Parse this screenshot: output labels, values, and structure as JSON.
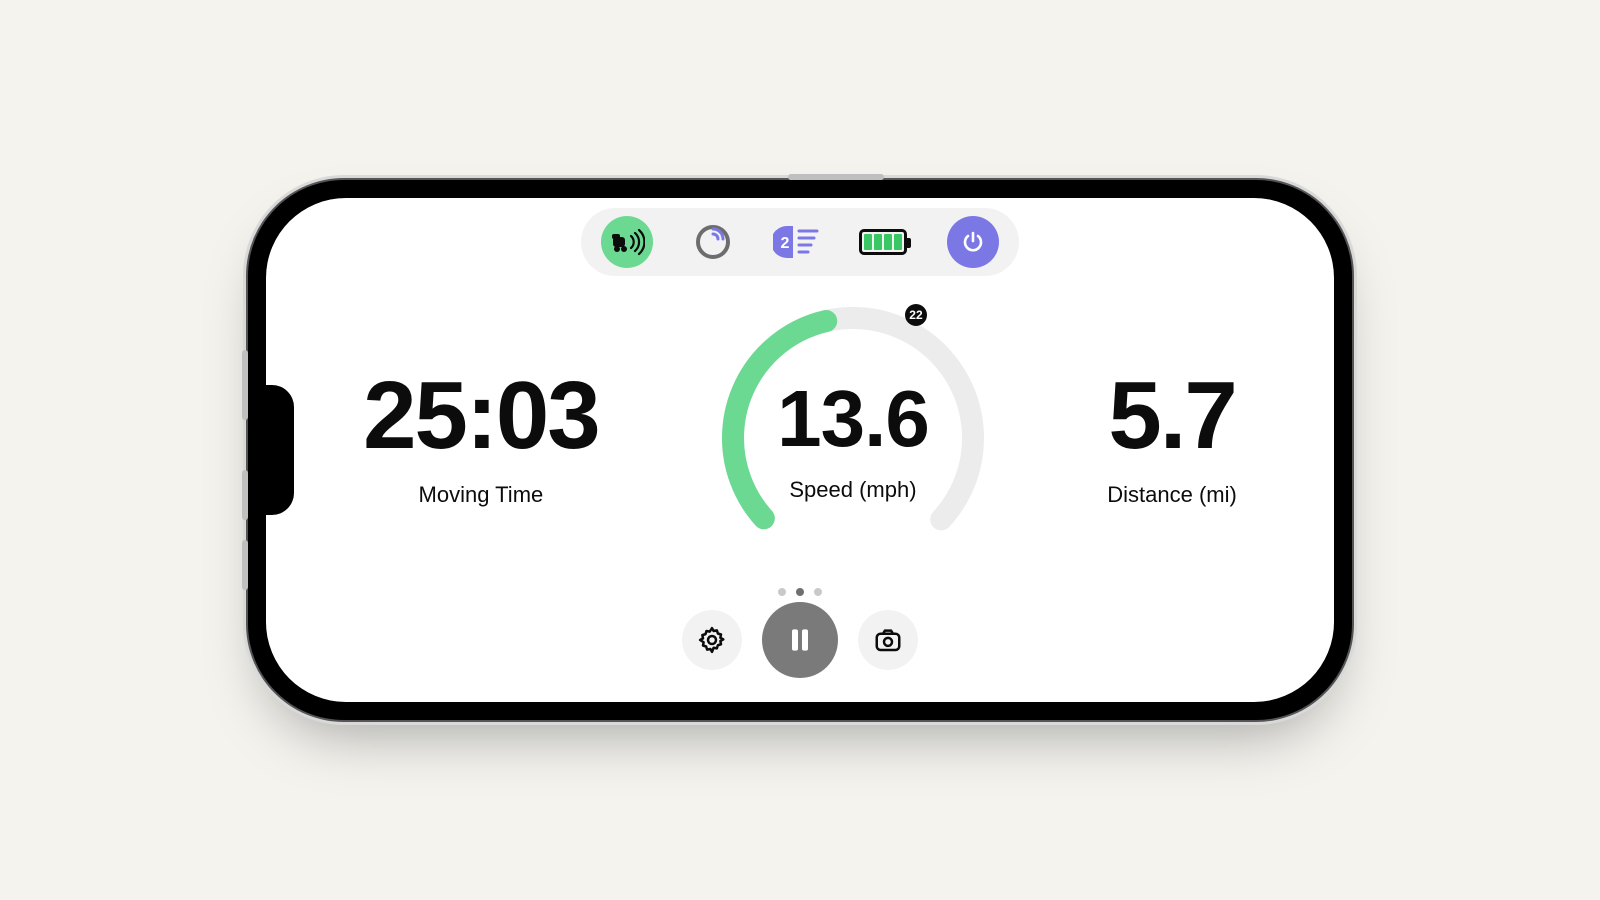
{
  "status": {
    "radar_active": true,
    "gps_loading": true,
    "sensor_count": "2",
    "battery_bars": 4,
    "power_on": true
  },
  "gauge": {
    "max_label": "22",
    "speed_value": "13.6",
    "speed_label": "Speed (mph)",
    "progress_fraction": 0.45,
    "arc_fraction": 0.735
  },
  "metrics": {
    "time_value": "25:03",
    "time_label": "Moving Time",
    "distance_value": "5.7",
    "distance_label": "Distance (mi)"
  },
  "pager": {
    "count": 3,
    "active_index": 1
  }
}
